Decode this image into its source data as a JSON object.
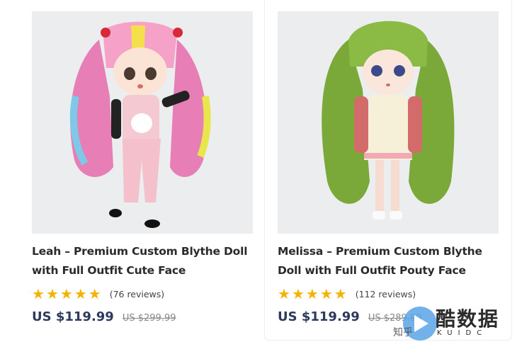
{
  "products": [
    {
      "title": "Leah – Premium Custom Blythe Doll with Full Outfit Cute Face",
      "reviews": "(76 reviews)",
      "price": "US $119.99",
      "old_price": "US $299.99",
      "rating": 5,
      "image_icon": "doll-pink-hair-image"
    },
    {
      "title": "Melissa – Premium Custom Blythe Doll with Full Outfit Pouty Face",
      "reviews": "(112 reviews)",
      "price": "US $119.99",
      "old_price": "US $289.99",
      "rating": 5,
      "image_icon": "doll-green-hair-image"
    }
  ],
  "stars": [
    "★",
    "★",
    "★",
    "★",
    "★"
  ],
  "watermark": {
    "main": "酷数据",
    "sub": "KUIDC",
    "left": "知乎"
  },
  "colors": {
    "star": "#f5b301",
    "price": "#2d3a5c",
    "old_price": "#888888"
  }
}
